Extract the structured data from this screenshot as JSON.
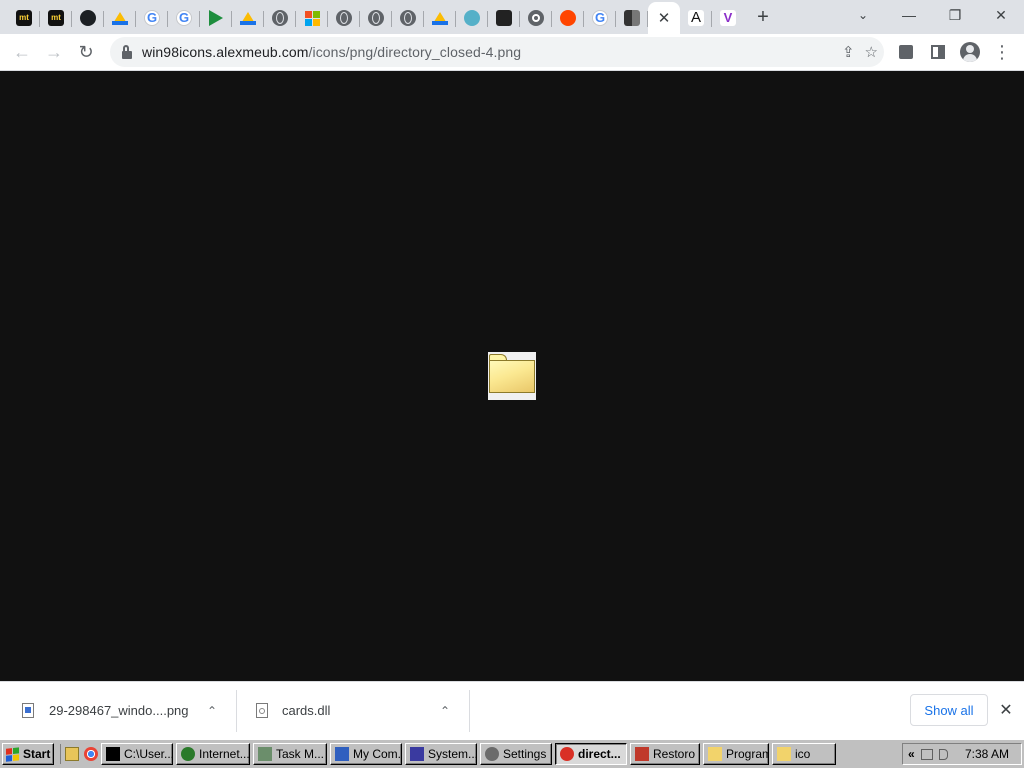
{
  "browser": {
    "tabs": [
      {
        "name": "tab-mt-1",
        "icon": "mt-icon",
        "glyph": "mt"
      },
      {
        "name": "tab-mt-2",
        "icon": "mt-icon",
        "glyph": "mt"
      },
      {
        "name": "tab-github",
        "icon": "github-icon",
        "glyph": ""
      },
      {
        "name": "tab-drive-1",
        "icon": "google-drive-icon",
        "glyph": ""
      },
      {
        "name": "tab-google-1",
        "icon": "google-icon",
        "glyph": "G"
      },
      {
        "name": "tab-google-2",
        "icon": "google-icon",
        "glyph": "G"
      },
      {
        "name": "tab-play",
        "icon": "play-icon",
        "glyph": ""
      },
      {
        "name": "tab-drive-2",
        "icon": "google-drive-icon",
        "glyph": ""
      },
      {
        "name": "tab-globe-1",
        "icon": "globe-icon",
        "glyph": ""
      },
      {
        "name": "tab-microsoft",
        "icon": "microsoft-icon",
        "glyph": ""
      },
      {
        "name": "tab-globe-2",
        "icon": "globe-icon",
        "glyph": ""
      },
      {
        "name": "tab-globe-3",
        "icon": "globe-icon",
        "glyph": ""
      },
      {
        "name": "tab-globe-4",
        "icon": "globe-icon",
        "glyph": ""
      },
      {
        "name": "tab-drive-3",
        "icon": "google-drive-icon",
        "glyph": ""
      },
      {
        "name": "tab-shell",
        "icon": "shell-icon",
        "glyph": ""
      },
      {
        "name": "tab-library",
        "icon": "library-icon",
        "glyph": ""
      },
      {
        "name": "tab-chrome",
        "icon": "chrome-icon",
        "glyph": ""
      },
      {
        "name": "tab-reddit",
        "icon": "reddit-icon",
        "glyph": ""
      },
      {
        "name": "tab-google-3",
        "icon": "google-icon",
        "glyph": "G"
      },
      {
        "name": "tab-mixed",
        "icon": "page-icon",
        "glyph": ""
      }
    ],
    "active_tab_close": "✕",
    "after_tabs": [
      {
        "name": "tab-font-a",
        "icon": "letter-a-icon",
        "glyph": "A"
      },
      {
        "name": "tab-vivaldi",
        "icon": "v-icon",
        "glyph": "V"
      }
    ],
    "new_tab": "+",
    "window_controls": {
      "tab_search": "⌄",
      "minimize": "—",
      "restore": "❐",
      "close": "✕"
    },
    "url_host": "win98icons.alexmeub.com",
    "url_path": "/icons/png/directory_closed-4.png",
    "nav": {
      "back": "←",
      "forward": "→",
      "reload": "↻"
    },
    "omnibox_icons": {
      "share": "⇪",
      "star": "☆"
    },
    "menu": "⋮"
  },
  "downloads": {
    "items": [
      {
        "name": "29-298467_windo....png",
        "chevron": "⌃"
      },
      {
        "name": "cards.dll",
        "chevron": "⌃"
      }
    ],
    "show_all": "Show all",
    "close": "✕"
  },
  "taskbar": {
    "start": "Start",
    "buttons": [
      {
        "label": "C:\\User...",
        "icon": "7zip-icon",
        "color": "#000000"
      },
      {
        "label": "Internet...",
        "icon": "globe-icon",
        "color": "#2a7a2a"
      },
      {
        "label": "Task M...",
        "icon": "task-manager-icon",
        "color": "#6b8e6b"
      },
      {
        "label": "My Com...",
        "icon": "computer-icon",
        "color": "#2f5fbf"
      },
      {
        "label": "System...",
        "icon": "system-icon",
        "color": "#3a3aa0"
      },
      {
        "label": "Settings",
        "icon": "gear-icon",
        "color": "#6b6b6b"
      },
      {
        "label": "direct...",
        "icon": "chrome-icon",
        "color": "#d93025",
        "pressed": true
      },
      {
        "label": "Restoro",
        "icon": "restoro-icon",
        "color": "#c0392b"
      },
      {
        "label": "Programs",
        "icon": "folder-icon",
        "color": "#f2d36b"
      },
      {
        "label": "ico",
        "icon": "folder-icon",
        "color": "#f2d36b"
      }
    ],
    "tray_chevron": "«",
    "clock": "7:38 AM"
  }
}
